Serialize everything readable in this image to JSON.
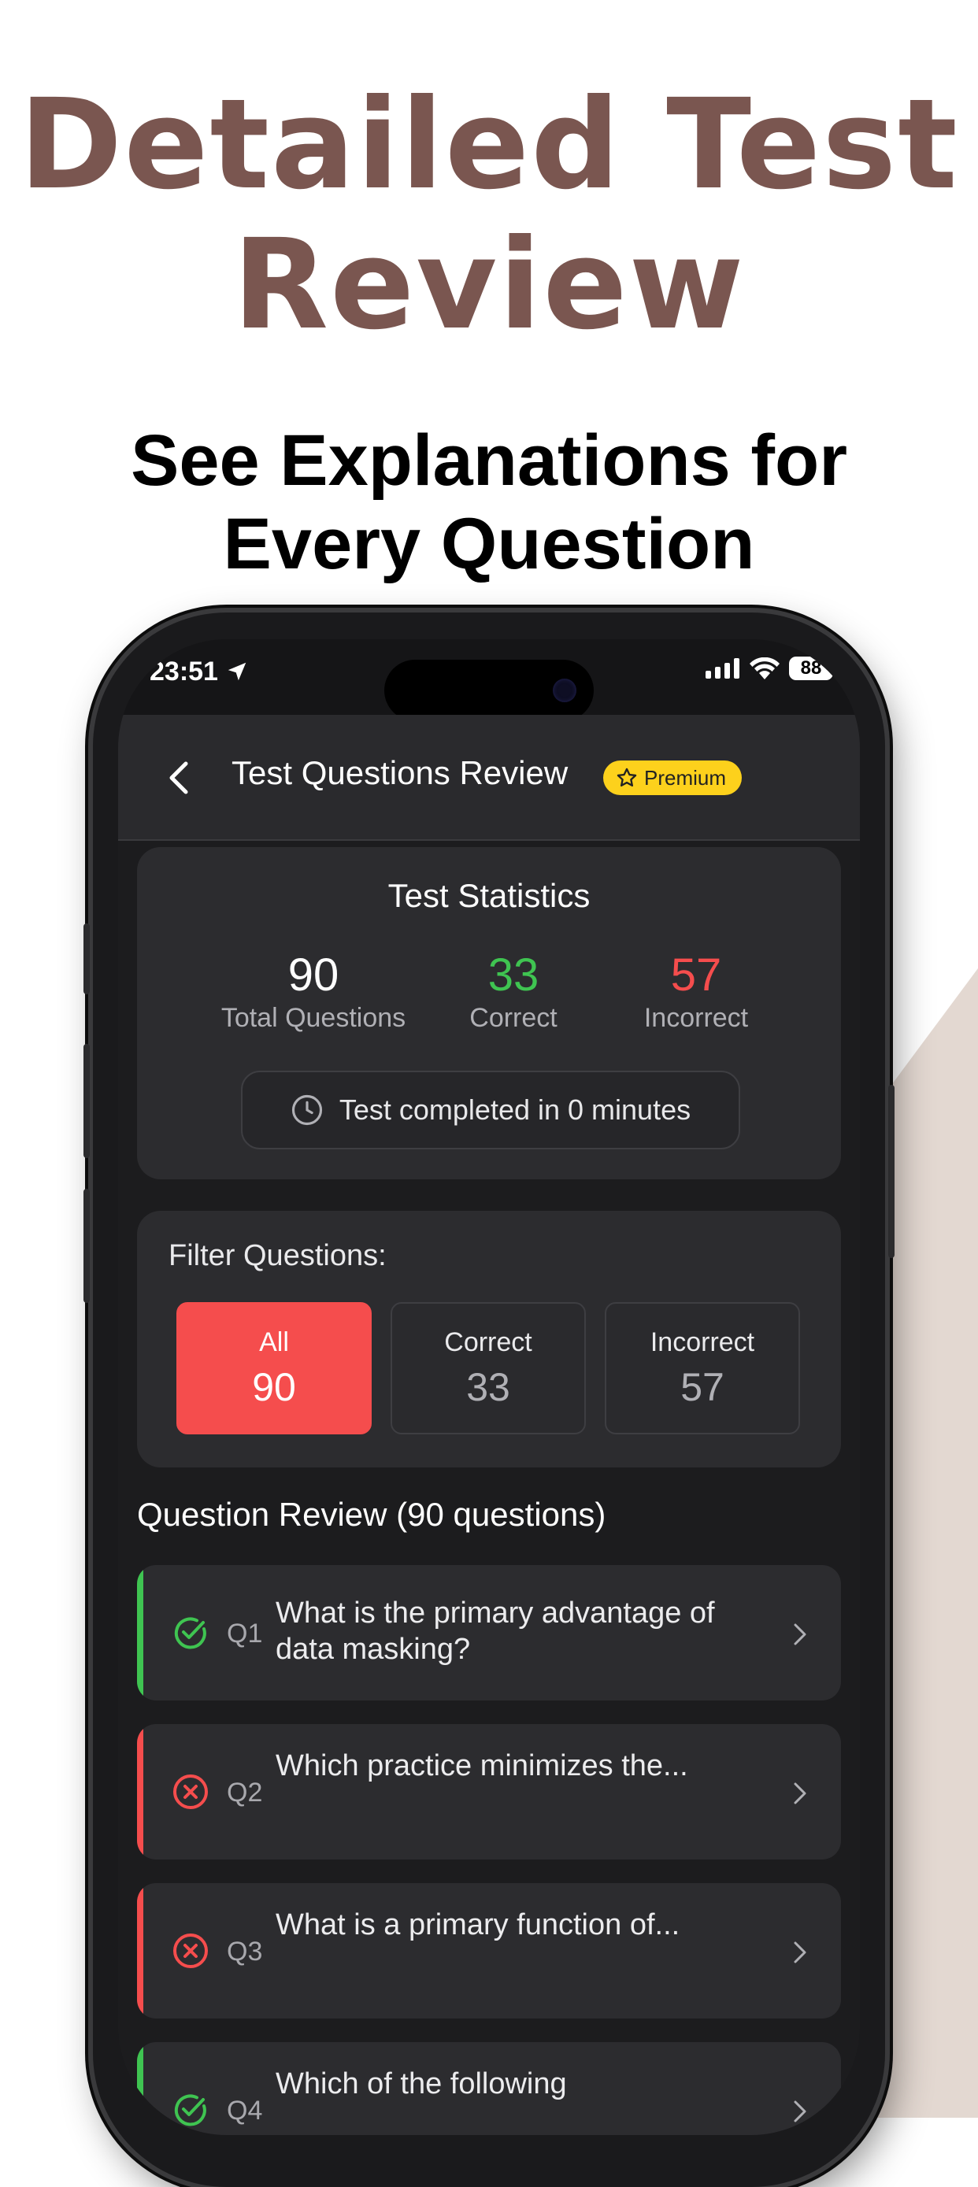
{
  "marketing": {
    "headline_line1": "Detailed Test",
    "headline_line2": "Review",
    "subhead_line1": "See Explanations for",
    "subhead_line2": "Every Question"
  },
  "status_bar": {
    "time": "23:51",
    "battery": "88"
  },
  "nav": {
    "title": "Test Questions Review",
    "badge": "Premium",
    "back_icon": "chevron-left-icon"
  },
  "stats": {
    "title": "Test Statistics",
    "total": {
      "value": "90",
      "label": "Total Questions"
    },
    "correct": {
      "value": "33",
      "label": "Correct"
    },
    "incorrect": {
      "value": "57",
      "label": "Incorrect"
    },
    "completed_text": "Test completed in 0 minutes"
  },
  "filter": {
    "label": "Filter Questions:",
    "options": [
      {
        "label": "All",
        "count": "90",
        "active": true
      },
      {
        "label": "Correct",
        "count": "33",
        "active": false
      },
      {
        "label": "Incorrect",
        "count": "57",
        "active": false
      }
    ]
  },
  "review": {
    "title": "Question Review (90  questions)",
    "questions": [
      {
        "num": "Q1",
        "status": "correct",
        "text": "What is the primary advantage of data masking?"
      },
      {
        "num": "Q2",
        "status": "incorrect",
        "text": "Which practice minimizes the..."
      },
      {
        "num": "Q3",
        "status": "incorrect",
        "text": "What is a primary function of..."
      },
      {
        "num": "Q4",
        "status": "correct",
        "text": "Which of the following"
      }
    ]
  },
  "colors": {
    "headline": "#7a5650",
    "correct": "#3fc451",
    "incorrect": "#f54d4d",
    "premium": "#fdd11c",
    "card": "#2c2c2f"
  }
}
